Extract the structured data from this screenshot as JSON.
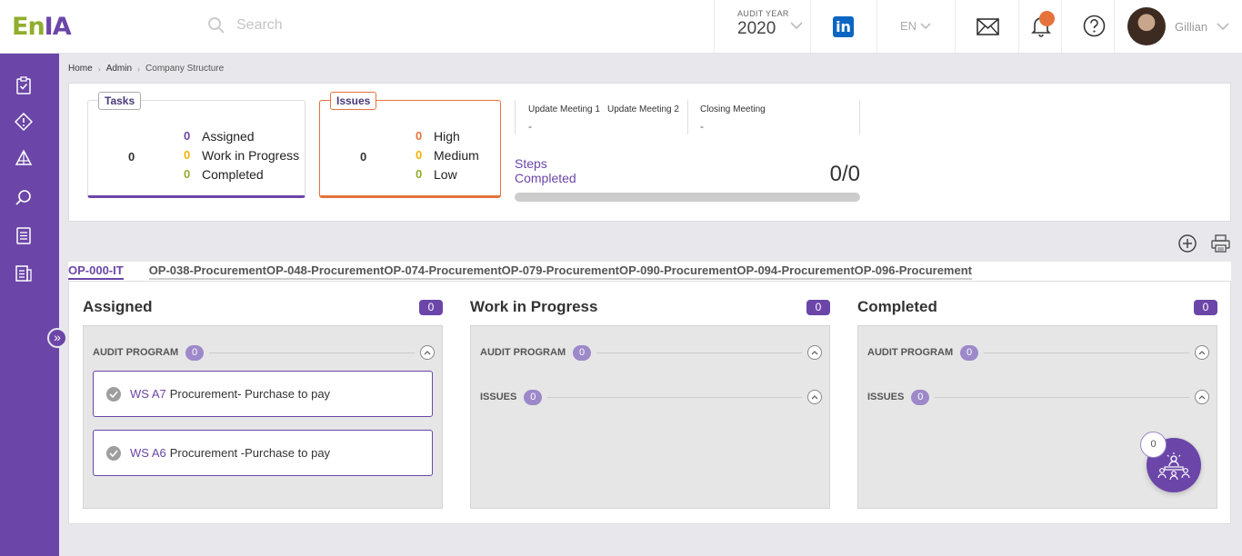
{
  "app": {
    "logo_en": "En",
    "logo_ia": "IA"
  },
  "search": {
    "placeholder": "Search"
  },
  "audit_year": {
    "label": "AUDIT YEAR",
    "value": "2020"
  },
  "language": {
    "value": "EN"
  },
  "user": {
    "name": "Gillian"
  },
  "breadcrumb": [
    "Home",
    "Admin",
    "Company Structure"
  ],
  "tasks": {
    "tag": "Tasks",
    "total": "0",
    "rows": [
      {
        "count": "0",
        "label": "Assigned",
        "color": "#6b46a8"
      },
      {
        "count": "0",
        "label": "Work in Progress",
        "color": "#f0b400"
      },
      {
        "count": "0",
        "label": "Completed",
        "color": "#8fae2c"
      }
    ]
  },
  "issues": {
    "tag": "Issues",
    "total": "0",
    "rows": [
      {
        "count": "0",
        "label": "High",
        "color": "#e5733b"
      },
      {
        "count": "0",
        "label": "Medium",
        "color": "#f0b400"
      },
      {
        "count": "0",
        "label": "Low",
        "color": "#8fae2c"
      }
    ]
  },
  "meetings": [
    {
      "label": "Update Meeting 1",
      "value": "-"
    },
    {
      "label": "Update Meeting 2",
      "value": ""
    },
    {
      "label": "Closing Meeting",
      "value": "-"
    }
  ],
  "steps": {
    "label_line1": "Steps",
    "label_line2": "Completed",
    "value": "0/0",
    "progress": 0
  },
  "tabs": [
    "OP-000-IT",
    "OP-038-Procurement",
    "OP-048-Procurement",
    "OP-074-Procurement",
    "OP-079-Procurement",
    "OP-090-Procurement",
    "OP-094-Procurement",
    "OP-096-Procurement"
  ],
  "columns": [
    {
      "title": "Assigned",
      "count": "0",
      "groups": [
        {
          "label": "AUDIT PROGRAM",
          "count": "0"
        }
      ],
      "cards": [
        {
          "id": "WS A7",
          "title": "Procurement- Purchase to pay"
        },
        {
          "id": "WS A6",
          "title": "Procurement -Purchase to pay"
        }
      ]
    },
    {
      "title": "Work in Progress",
      "count": "0",
      "groups": [
        {
          "label": "AUDIT PROGRAM",
          "count": "0"
        },
        {
          "label": "ISSUES",
          "count": "0"
        }
      ]
    },
    {
      "title": "Completed",
      "count": "0",
      "groups": [
        {
          "label": "AUDIT PROGRAM",
          "count": "0"
        },
        {
          "label": "ISSUES",
          "count": "0"
        }
      ]
    }
  ],
  "fab": {
    "badge": "0"
  },
  "colors": {
    "accent": "#6b46a8",
    "orange": "#e5733b",
    "green": "#8fae2c",
    "yellow": "#f0b400"
  }
}
